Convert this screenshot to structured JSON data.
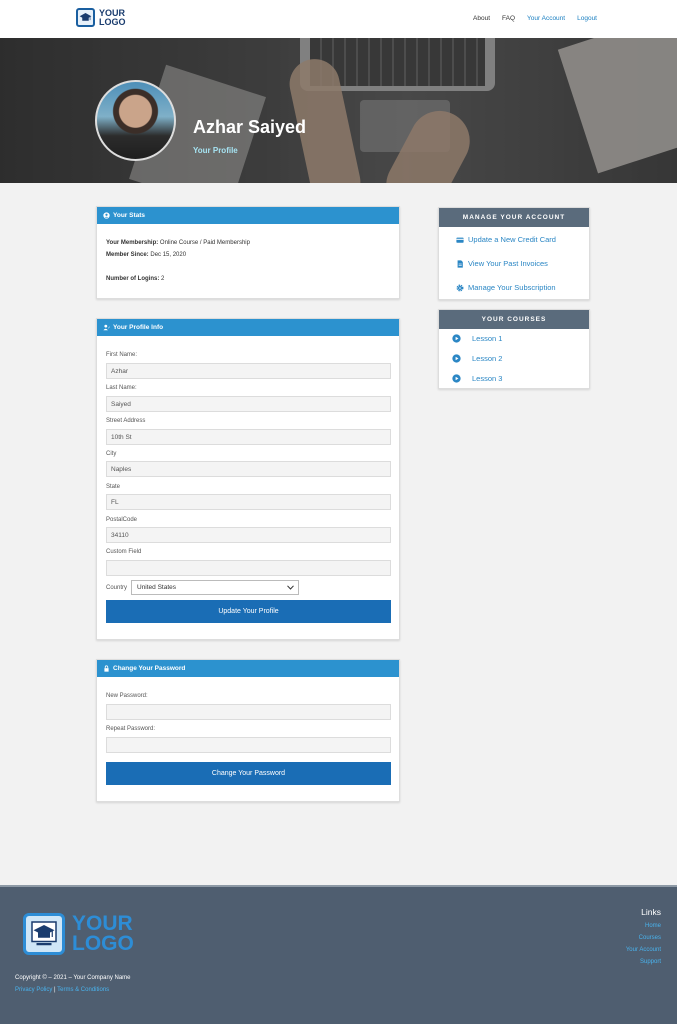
{
  "header": {
    "logo_line1": "YOUR",
    "logo_line2": "LOGO",
    "nav": [
      "About",
      "FAQ",
      "Your Account",
      "Logout"
    ]
  },
  "hero": {
    "name": "Azhar Saiyed",
    "subtitle": "Your Profile"
  },
  "stats": {
    "title": "Your Stats",
    "membership_label": "Your Membership:",
    "membership_value": "Online Course / Paid Membership",
    "since_label": "Member Since:",
    "since_value": "Dec 15, 2020",
    "logins_label": "Number of Logins:",
    "logins_value": "2"
  },
  "profile": {
    "title": "Your Profile Info",
    "fields": [
      {
        "label": "First Name:",
        "value": "Azhar"
      },
      {
        "label": "Last Name:",
        "value": "Saiyed"
      },
      {
        "label": "Street Address",
        "value": "10th St"
      },
      {
        "label": "City",
        "value": "Naples"
      },
      {
        "label": "State",
        "value": "FL"
      },
      {
        "label": "PostalCode",
        "value": "34110"
      },
      {
        "label": "Custom Field",
        "value": ""
      }
    ],
    "country_label": "Country",
    "country_value": "United States",
    "submit": "Update Your Profile"
  },
  "password": {
    "title": "Change Your Password",
    "new_label": "New Password:",
    "repeat_label": "Repeat Password:",
    "submit": "Change Your Password"
  },
  "manage": {
    "title": "MANAGE YOUR ACCOUNT",
    "links": [
      "Update a New Credit Card",
      "View Your Past Invoices",
      "Manage Your Subscription"
    ]
  },
  "courses": {
    "title": "YOUR COURSES",
    "items": [
      "Lesson 1",
      "Lesson 2",
      "Lesson 3"
    ]
  },
  "footer": {
    "logo_line1": "YOUR",
    "logo_line2": "LOGO",
    "copyright": "Copyright © – 2021 – Your Company Name",
    "privacy": "Privacy Policy",
    "separator": "|",
    "terms": "Terms & Conditions",
    "links_title": "Links",
    "links": [
      "Home",
      "Courses",
      "Your Account",
      "Support"
    ]
  },
  "colors": {
    "accent": "#2c92cf",
    "button": "#1a6db5",
    "dark_header": "#5a6b7c",
    "footer": "#4f5e70",
    "link": "#2a86c4"
  }
}
